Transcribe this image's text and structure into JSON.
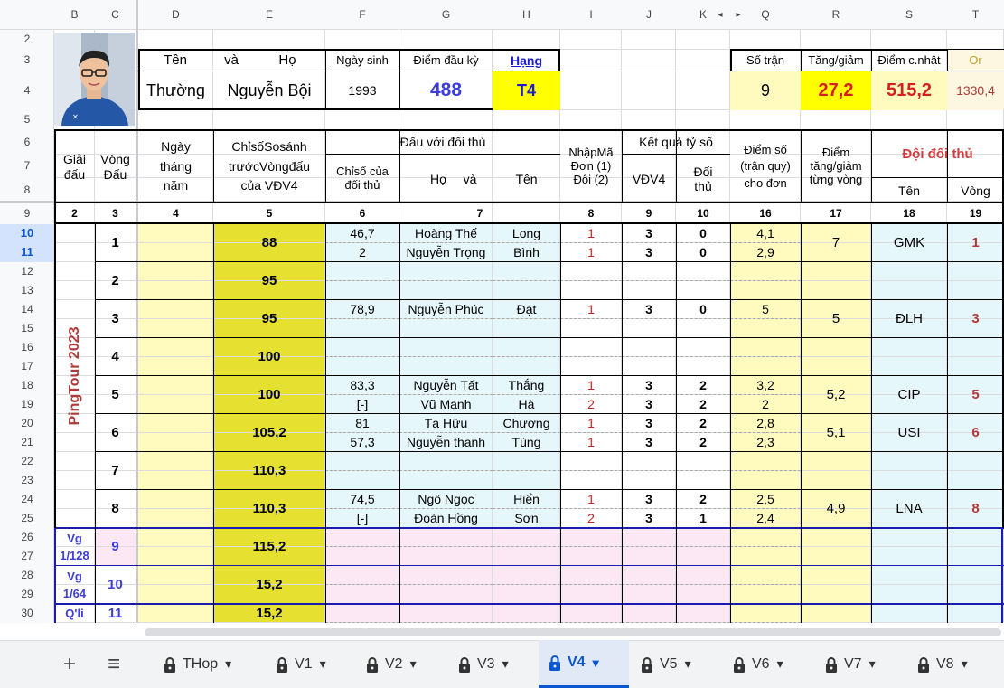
{
  "columns": [
    "B",
    "C",
    "D",
    "E",
    "F",
    "G",
    "H",
    "I",
    "J",
    "K",
    "Q",
    "R",
    "S",
    "T"
  ],
  "row_numbers": [
    "2",
    "3",
    "4",
    "5",
    "6",
    "7",
    "8",
    "9",
    "10",
    "11",
    "12",
    "13",
    "14",
    "15",
    "16",
    "17",
    "18",
    "19",
    "20",
    "21",
    "22",
    "23",
    "24",
    "25",
    "26",
    "27",
    "28",
    "29",
    "30"
  ],
  "profile": {
    "header_ten": "Tên",
    "header_va": "và",
    "header_ho": "Họ",
    "header_ngay_sinh": "Ngày sinh",
    "header_diem_dau_ky": "Điểm đầu kỳ",
    "header_hang": "Hạng",
    "ten": "Thường",
    "ho": "Nguyễn Bội",
    "ngay_sinh": "1993",
    "diem_dau_ky": "488",
    "hang": "T4"
  },
  "summary": {
    "so_tran_label": "Số trận",
    "tang_giam_label": "Tăng/giảm",
    "diem_cnhat_label": "Điểm c.nhật",
    "or_label": "Or",
    "so_tran": "9",
    "tang_giam": "27,2",
    "diem_cnhat": "515,2",
    "or_value": "1330,4"
  },
  "headers": {
    "giai_dau": "Giải đấu",
    "vong_dau": "Vòng Đấu",
    "ngay_thang_nam": "Ngày tháng năm",
    "chiso": "ChỉsốSosánh trướcVòngđấu của VĐV4",
    "dau_voi_doi_thu": "Đấu với đối thủ",
    "chiso_doi_thu": "Chỉsố của đối thủ",
    "ho": "Họ",
    "va": "và",
    "ten": "Tên",
    "nhapma": "NhậpMã Đơn (1) Đôi (2)",
    "ket_qua": "Kết quả tỷ số",
    "vdv4": "VĐV4",
    "doi_thu": "Đối thủ",
    "diem_so": "Điểm số (trận quy) cho đơn",
    "diem_tang_giam": "Điểm tăng/giảm từng vòng",
    "doi_doi_thu": "Đội đối thủ",
    "ten_doi": "Tên",
    "vong": "Vòng"
  },
  "col_numbers": [
    "2",
    "3",
    "4",
    "5",
    "6",
    "7",
    "8",
    "9",
    "10",
    "16",
    "17",
    "18",
    "19"
  ],
  "giai_dau_label": "PingTour 2023",
  "vg_labels": [
    "Vg 1/128",
    "Vg 1/64",
    "Q'li"
  ],
  "rounds": [
    {
      "vong": "1",
      "chiso": "88",
      "a": {
        "cs": "46,7",
        "ho": "Hoàng Thế",
        "ten": "Long",
        "ma": "1",
        "v": "3",
        "d": "0",
        "ds": "4,1"
      },
      "b": {
        "cs": "2",
        "ho": "Nguyễn Trọng",
        "ten": "Bình",
        "ma": "1",
        "v": "3",
        "d": "0",
        "ds": "2,9"
      },
      "tg": "7",
      "team": "GMK",
      "tv": "1"
    },
    {
      "vong": "2",
      "chiso": "95"
    },
    {
      "vong": "3",
      "chiso": "95",
      "a": {
        "cs": "78,9",
        "ho": "Nguyễn Phúc",
        "ten": "Đạt",
        "ma": "1",
        "v": "3",
        "d": "0",
        "ds": "5"
      },
      "tg": "5",
      "team": "ĐLH",
      "tv": "3"
    },
    {
      "vong": "4",
      "chiso": "100"
    },
    {
      "vong": "5",
      "chiso": "100",
      "a": {
        "cs": "83,3",
        "ho": "Nguyễn Tất",
        "ten": "Thắng",
        "ma": "1",
        "v": "3",
        "d": "2",
        "ds": "3,2"
      },
      "b": {
        "cs": "[-]",
        "ho": "Vũ Mạnh",
        "ten": "Hà",
        "ma": "2",
        "v": "3",
        "d": "2",
        "ds": "2"
      },
      "tg": "5,2",
      "team": "CIP",
      "tv": "5"
    },
    {
      "vong": "6",
      "chiso": "105,2",
      "a": {
        "cs": "81",
        "ho": "Tạ Hữu",
        "ten": "Chương",
        "ma": "1",
        "v": "3",
        "d": "2",
        "ds": "2,8"
      },
      "b": {
        "cs": "57,3",
        "ho": "Nguyễn thanh",
        "ten": "Tùng",
        "ma": "1",
        "v": "3",
        "d": "2",
        "ds": "2,3"
      },
      "tg": "5,1",
      "team": "USI",
      "tv": "6"
    },
    {
      "vong": "7",
      "chiso": "110,3"
    },
    {
      "vong": "8",
      "chiso": "110,3",
      "a": {
        "cs": "74,5",
        "ho": "Ngô Ngọc",
        "ten": "Hiển",
        "ma": "1",
        "v": "3",
        "d": "2",
        "ds": "2,5"
      },
      "b": {
        "cs": "[-]",
        "ho": "Đoàn Hồng",
        "ten": "Sơn",
        "ma": "2",
        "v": "3",
        "d": "1",
        "ds": "2,4"
      },
      "tg": "4,9",
      "team": "LNA",
      "tv": "8"
    },
    {
      "vong": "9",
      "chiso": "115,2"
    },
    {
      "vong": "10",
      "chiso": "15,2"
    },
    {
      "vong": "11",
      "chiso": "15,2"
    }
  ],
  "tabs": [
    {
      "label": "THop"
    },
    {
      "label": "V1"
    },
    {
      "label": "V2"
    },
    {
      "label": "V3"
    },
    {
      "label": "V4"
    },
    {
      "label": "V5"
    },
    {
      "label": "V6"
    },
    {
      "label": "V7"
    },
    {
      "label": "V8"
    }
  ],
  "icons": {
    "add": "+",
    "menu": "≡",
    "lock": "lock-icon",
    "caret": "▾"
  },
  "colors": {
    "yellow_dark": "#e6e030",
    "yellow_light": "#fffbbf",
    "yellow_bright": "#ffff00",
    "cyan_light": "#e6f7fb",
    "pink_light": "#fce8f4",
    "blue_text": "#3d3ddb",
    "maroon": "#b03a3a",
    "accent": "#0b57d0"
  }
}
